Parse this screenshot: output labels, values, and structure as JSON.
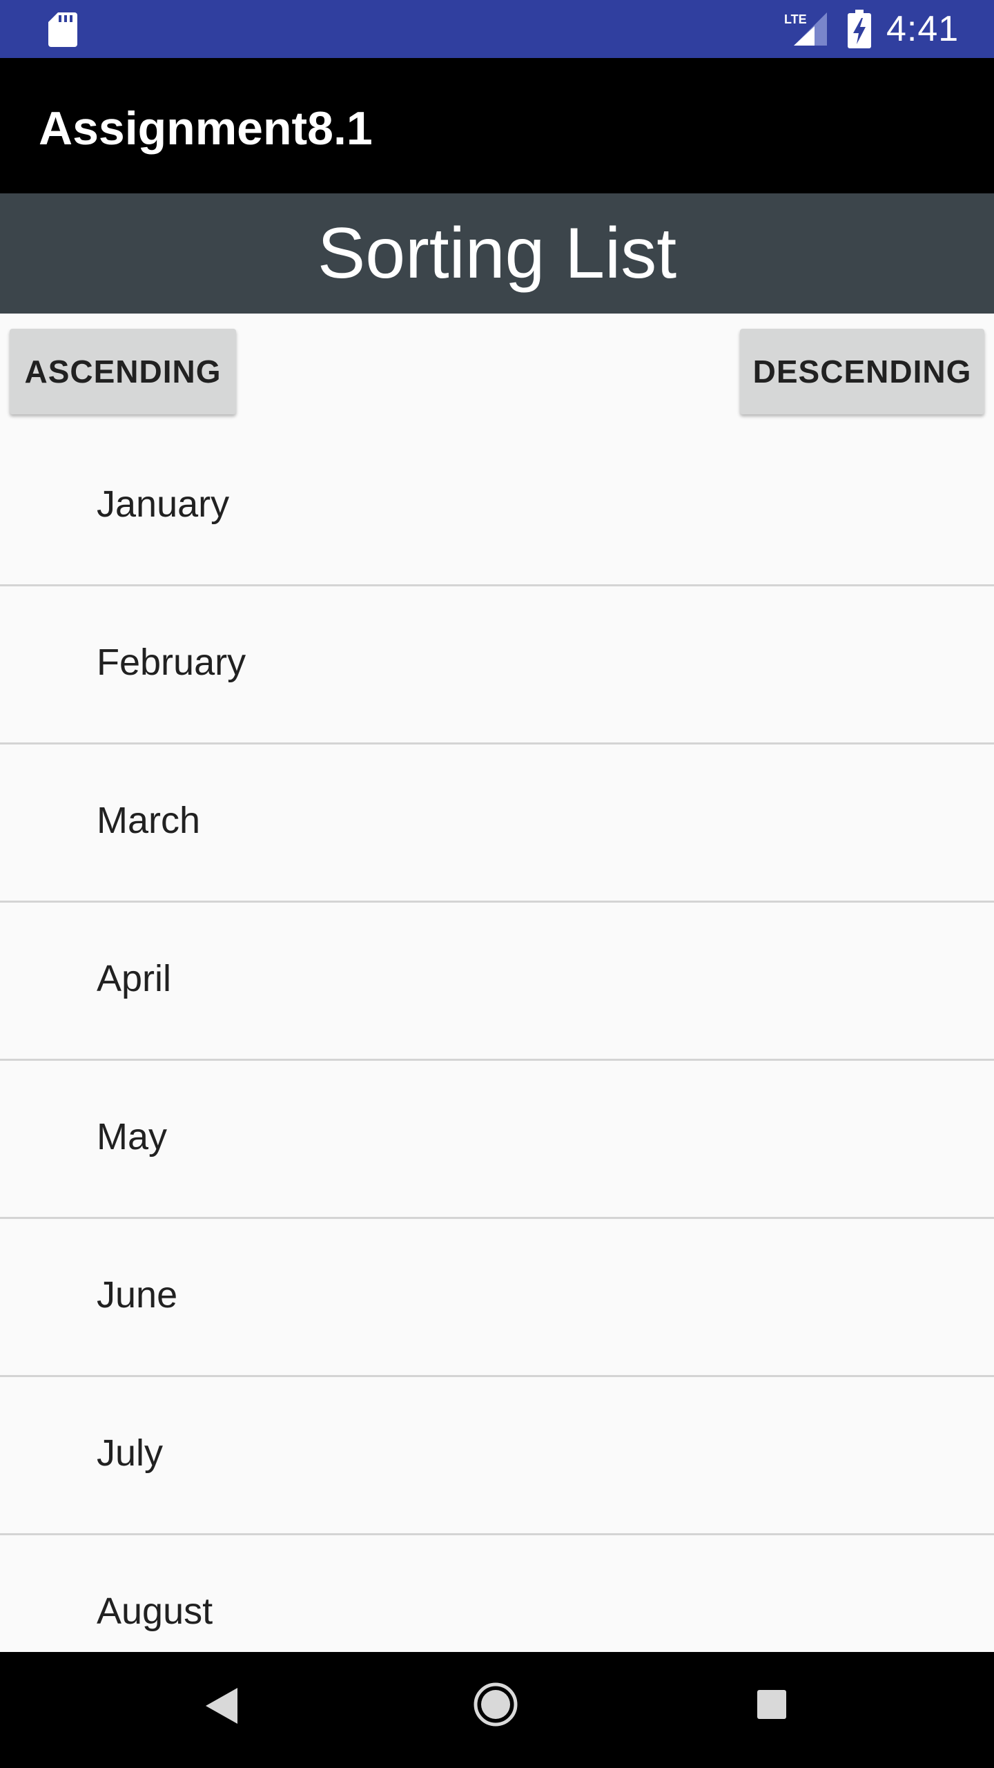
{
  "status_bar": {
    "time": "4:41",
    "network_label": "LTE",
    "icons": [
      "sd-card-icon",
      "lte-signal-icon",
      "battery-charging-icon"
    ]
  },
  "app_bar": {
    "title": "Assignment8.1"
  },
  "header": {
    "title": "Sorting List"
  },
  "buttons": {
    "ascending_label": "ASCENDING",
    "descending_label": "DESCENDING"
  },
  "months": [
    "January",
    "February",
    "March",
    "April",
    "May",
    "June",
    "July",
    "August"
  ],
  "nav_bar": {
    "icons": [
      "back-icon",
      "home-icon",
      "recents-icon"
    ]
  },
  "colors": {
    "status_bar": "#303f9f",
    "app_bar": "#000000",
    "header": "#3c454b",
    "button": "#d6d7d7",
    "background": "#fafafa"
  }
}
